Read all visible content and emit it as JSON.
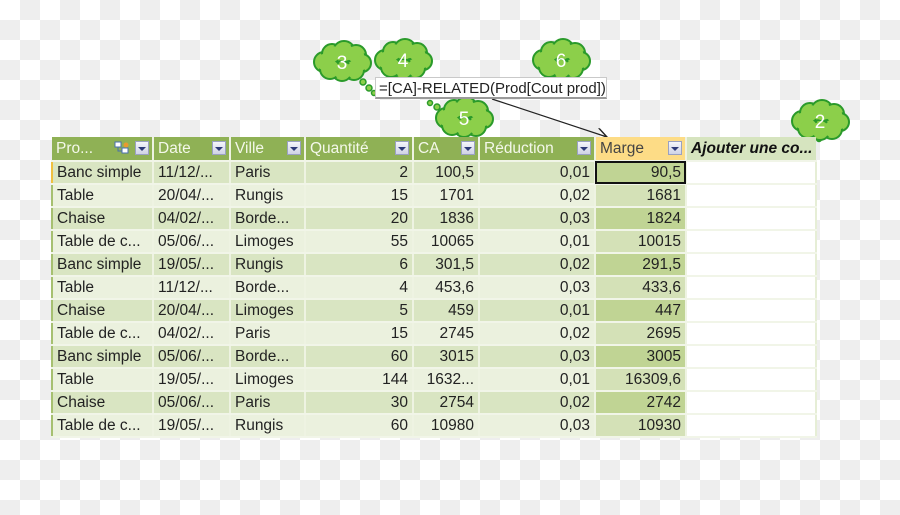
{
  "formula": "=[CA]-RELATED(Prod[Cout prod])",
  "callouts": [
    {
      "id": "3",
      "label": "3"
    },
    {
      "id": "4",
      "label": "4"
    },
    {
      "id": "5",
      "label": "5"
    },
    {
      "id": "6",
      "label": "6"
    },
    {
      "id": "2",
      "label": "2"
    }
  ],
  "columns": [
    "Pro...",
    "Date",
    "Ville",
    "Quantité",
    "CA",
    "Réduction",
    "Marge",
    "Ajouter une co..."
  ],
  "rows": [
    {
      "prod": "Banc simple",
      "date": "11/12/...",
      "ville": "Paris",
      "qte": "2",
      "ca": "100,5",
      "red": "0,01",
      "marge": "90,5"
    },
    {
      "prod": "Table",
      "date": "20/04/...",
      "ville": "Rungis",
      "qte": "15",
      "ca": "1701",
      "red": "0,02",
      "marge": "1681"
    },
    {
      "prod": "Chaise",
      "date": "04/02/...",
      "ville": "Borde...",
      "qte": "20",
      "ca": "1836",
      "red": "0,03",
      "marge": "1824"
    },
    {
      "prod": "Table de c...",
      "date": "05/06/...",
      "ville": "Limoges",
      "qte": "55",
      "ca": "10065",
      "red": "0,01",
      "marge": "10015"
    },
    {
      "prod": "Banc simple",
      "date": "19/05/...",
      "ville": "Rungis",
      "qte": "6",
      "ca": "301,5",
      "red": "0,02",
      "marge": "291,5"
    },
    {
      "prod": "Table",
      "date": "11/12/...",
      "ville": "Borde...",
      "qte": "4",
      "ca": "453,6",
      "red": "0,03",
      "marge": "433,6"
    },
    {
      "prod": "Chaise",
      "date": "20/04/...",
      "ville": "Limoges",
      "qte": "5",
      "ca": "459",
      "red": "0,01",
      "marge": "447"
    },
    {
      "prod": "Table de c...",
      "date": "04/02/...",
      "ville": "Paris",
      "qte": "15",
      "ca": "2745",
      "red": "0,02",
      "marge": "2695"
    },
    {
      "prod": "Banc simple",
      "date": "05/06/...",
      "ville": "Borde...",
      "qte": "60",
      "ca": "3015",
      "red": "0,03",
      "marge": "3005"
    },
    {
      "prod": "Table",
      "date": "19/05/...",
      "ville": "Limoges",
      "qte": "144",
      "ca": "1632...",
      "red": "0,01",
      "marge": "16309,6"
    },
    {
      "prod": "Chaise",
      "date": "05/06/...",
      "ville": "Paris",
      "qte": "30",
      "ca": "2754",
      "red": "0,02",
      "marge": "2742"
    },
    {
      "prod": "Table de c...",
      "date": "19/05/...",
      "ville": "Rungis",
      "qte": "60",
      "ca": "10980",
      "red": "0,03",
      "marge": "10930"
    }
  ],
  "selected_cell": {
    "row": 0,
    "column": "Marge"
  },
  "colors": {
    "header_green": "#8fb155",
    "marge_header": "#fddc86",
    "callout_green": "#8ccf4a",
    "callout_border": "#2a9a2a"
  }
}
